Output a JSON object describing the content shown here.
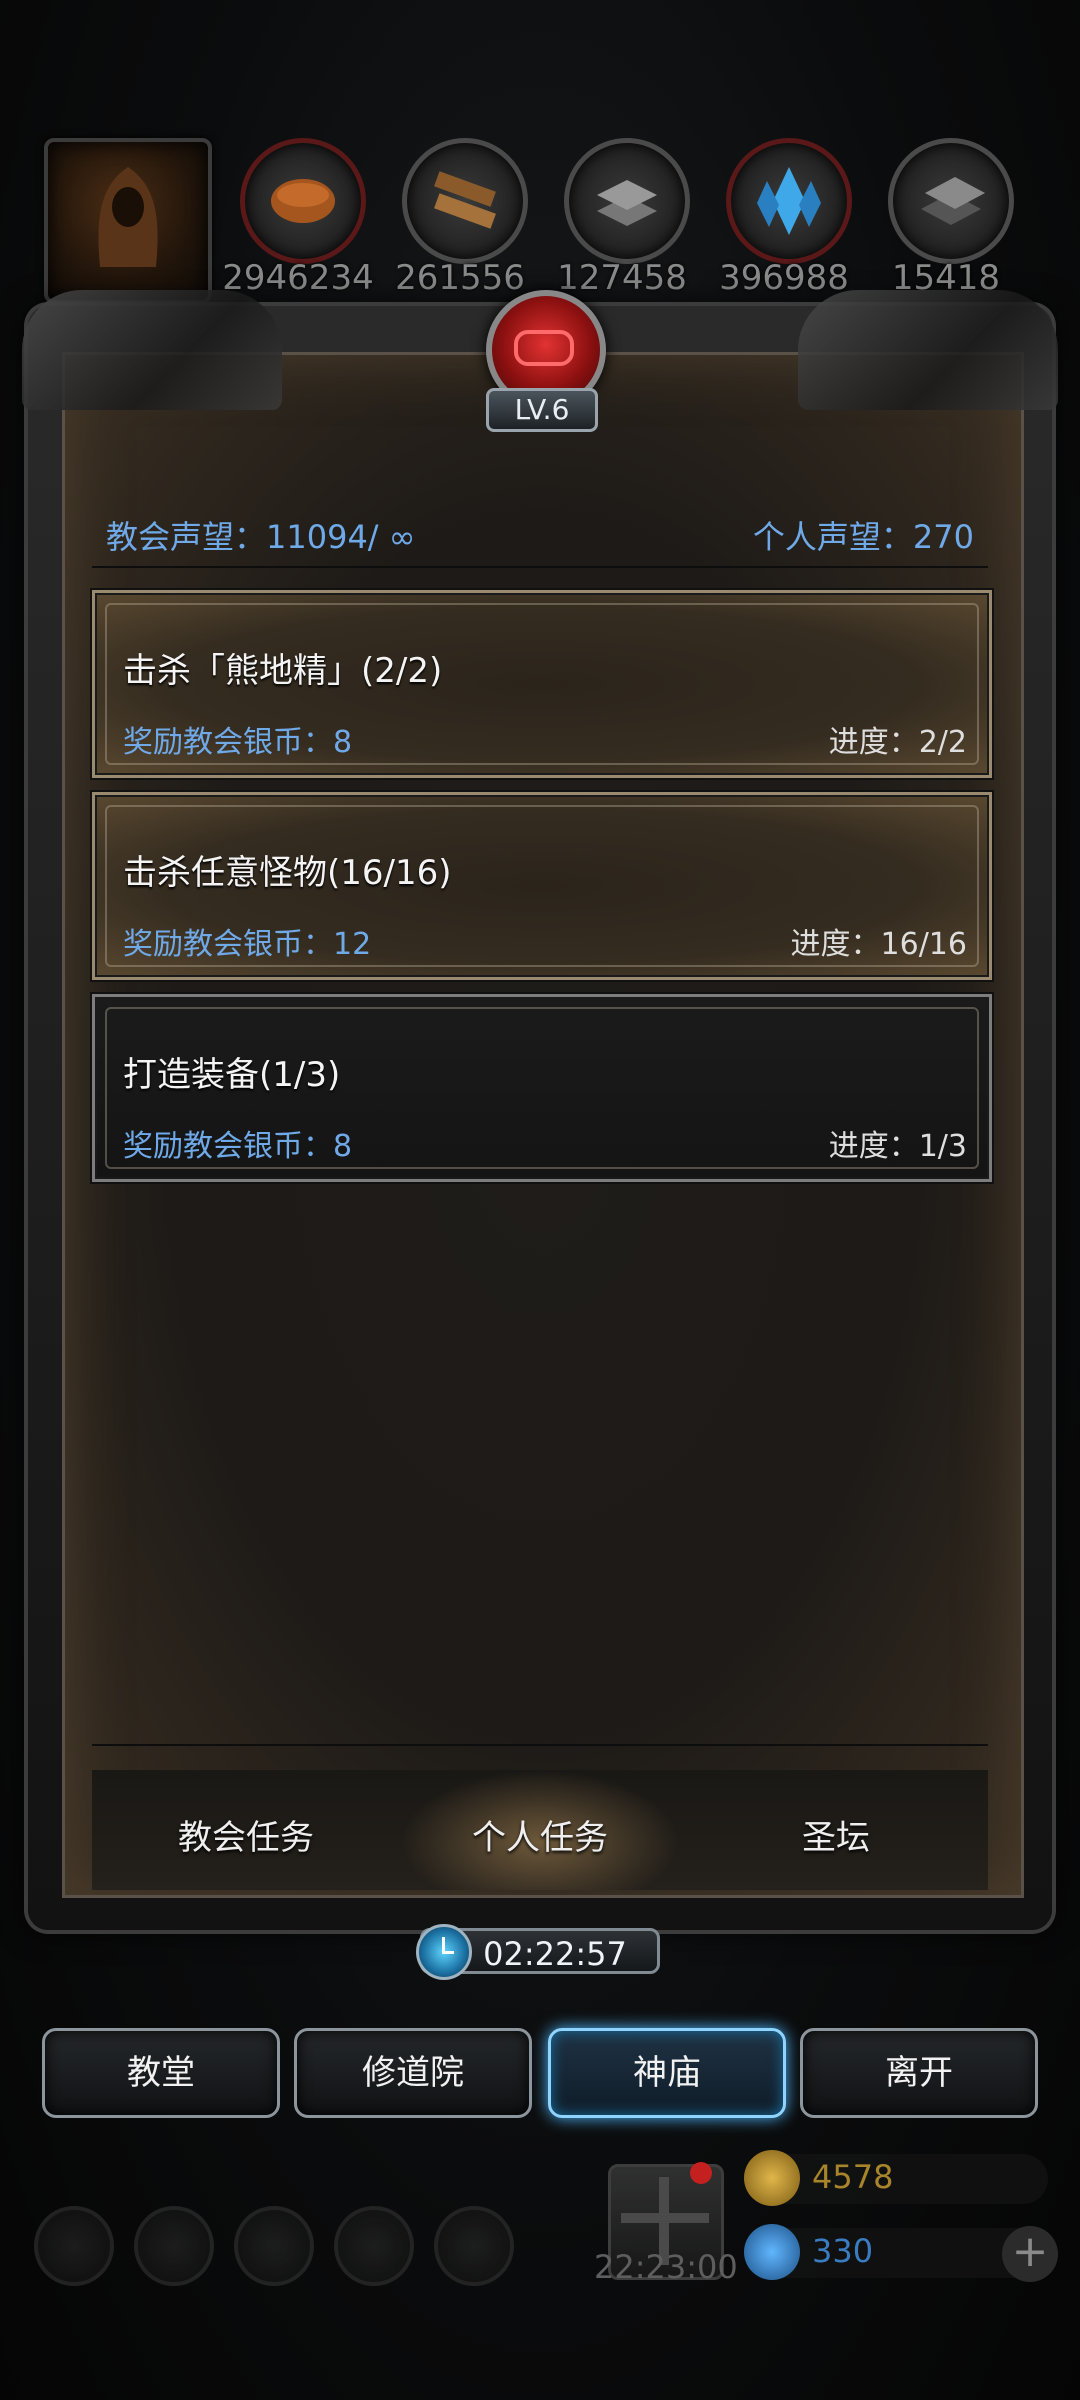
{
  "resources": [
    {
      "icon": "bread-icon",
      "value": "2946234"
    },
    {
      "icon": "wood-icon",
      "value": "261556"
    },
    {
      "icon": "iron-icon",
      "value": "127458"
    },
    {
      "icon": "crystal-icon",
      "value": "396988"
    },
    {
      "icon": "steel-icon",
      "value": "15418"
    }
  ],
  "panel": {
    "level": "LV.6",
    "church_reputation": "教会声望：11094/ ∞",
    "personal_reputation": "个人声望：270"
  },
  "tasks": [
    {
      "title": "击杀「熊地精」(2/2)",
      "reward": "奖励教会银币：8",
      "progress": "进度：2/2",
      "style": "gold"
    },
    {
      "title": "击杀任意怪物(16/16)",
      "reward": "奖励教会银币：12",
      "progress": "进度：16/16",
      "style": "gold"
    },
    {
      "title": "打造装备(1/3)",
      "reward": "奖励教会银币：8",
      "progress": "进度：1/3",
      "style": "gray"
    }
  ],
  "tabs": [
    {
      "label": "教会任务",
      "active": false
    },
    {
      "label": "个人任务",
      "active": true
    },
    {
      "label": "圣坛",
      "active": false
    }
  ],
  "timer": "02:22:57",
  "nav": [
    {
      "label": "教堂",
      "active": false
    },
    {
      "label": "修道院",
      "active": false
    },
    {
      "label": "神庙",
      "active": true
    },
    {
      "label": "离开",
      "active": false
    }
  ],
  "footer": {
    "gift_timer": "22:23:00",
    "gold": "4578",
    "gems": "330"
  },
  "colors": {
    "accent_blue": "#6fa9e8",
    "gold_text": "#a8852a",
    "active_glow": "#4fb8ff"
  }
}
